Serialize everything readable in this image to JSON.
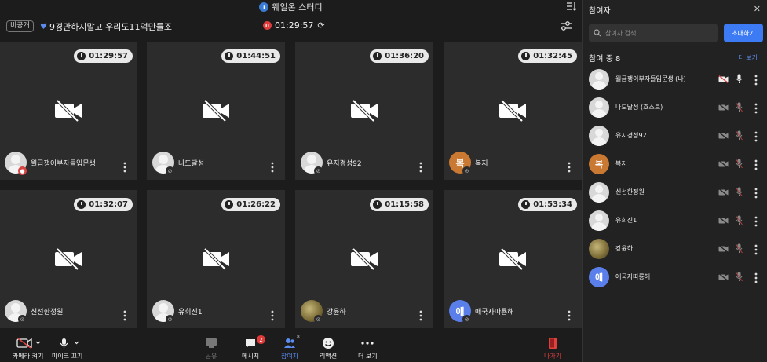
{
  "title_bar": {
    "title": "웨일온 스터디",
    "info_icon": "info-icon",
    "sort_icon": "sort-icon"
  },
  "header": {
    "private_badge": "비공개",
    "room_name": "9경만하지말고 우리도11억만들조",
    "timer": "01:29:57",
    "reset_icon": "refresh-icon",
    "settings_icon": "sliders-icon"
  },
  "tiles": [
    {
      "name": "월급쟁이부자들입문생",
      "time": "01:29:57",
      "avatar": "default",
      "mic": "red"
    },
    {
      "name": "나도달성",
      "time": "01:44:51",
      "avatar": "default",
      "mic": "muted"
    },
    {
      "name": "유지경성92",
      "time": "01:36:20",
      "avatar": "default",
      "mic": "muted"
    },
    {
      "name": "복지",
      "time": "01:32:45",
      "avatar": "letter",
      "letter": "복",
      "mic": "muted"
    },
    {
      "name": "신선한정원",
      "time": "01:32:07",
      "avatar": "default",
      "mic": "muted"
    },
    {
      "name": "유희진1",
      "time": "01:26:22",
      "avatar": "default",
      "mic": "muted"
    },
    {
      "name": "강윤하",
      "time": "01:15:58",
      "avatar": "photo",
      "mic": "muted"
    },
    {
      "name": "애국자따룡해",
      "time": "01:53:34",
      "avatar": "blue",
      "letter": "애",
      "mic": "muted"
    }
  ],
  "toolbar": {
    "camera_label": "카메라 켜기",
    "mic_label": "마이크 끄기",
    "share_label": "공유",
    "message_label": "메시지",
    "message_badge": "2",
    "participants_label": "참여자",
    "participants_count": "8",
    "reaction_label": "리액션",
    "more_label": "더 보기",
    "leave_label": "나가기"
  },
  "panel": {
    "title": "참여자",
    "search_placeholder": "참여자 검색",
    "invite_label": "초대하기",
    "count_label": "참여 중 8",
    "more_link": "더 보기",
    "participants": [
      {
        "name": "월급쟁이부자들입문생 (나)",
        "avatar": "default",
        "cam": "off-active",
        "mic": "on"
      },
      {
        "name": "나도달성 (호스트)",
        "avatar": "default",
        "cam": "off",
        "mic": "off"
      },
      {
        "name": "유지경성92",
        "avatar": "default",
        "cam": "off",
        "mic": "off"
      },
      {
        "name": "복지",
        "avatar": "letter",
        "letter": "복",
        "cam": "off",
        "mic": "off"
      },
      {
        "name": "신선한정원",
        "avatar": "default",
        "cam": "off",
        "mic": "off"
      },
      {
        "name": "유희진1",
        "avatar": "default",
        "cam": "off",
        "mic": "off"
      },
      {
        "name": "강윤하",
        "avatar": "photo",
        "cam": "off",
        "mic": "off"
      },
      {
        "name": "애국자따룡해",
        "avatar": "blue",
        "letter": "애",
        "cam": "off",
        "mic": "off"
      }
    ]
  },
  "colors": {
    "accent": "#3d7bf4",
    "danger": "#e0413f",
    "tile_bg": "#2c2c2c",
    "orange_avatar": "#c97932",
    "blue_avatar": "#5b7fea"
  }
}
